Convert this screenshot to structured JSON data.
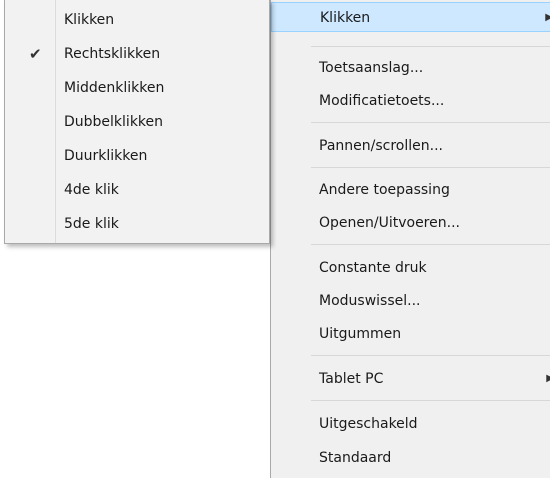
{
  "submenu": {
    "items": [
      {
        "label": "Klikken",
        "checked": false
      },
      {
        "label": "Rechtsklikken",
        "checked": true
      },
      {
        "label": "Middenklikken",
        "checked": false
      },
      {
        "label": "Dubbelklikken",
        "checked": false
      },
      {
        "label": "Duurklikken",
        "checked": false
      },
      {
        "label": "4de klik",
        "checked": false
      },
      {
        "label": "5de klik",
        "checked": false
      }
    ],
    "check_glyph": "✔"
  },
  "mainmenu": {
    "items": [
      {
        "label": "Klikken",
        "highlighted": true,
        "has_submenu": true
      },
      {
        "label": "Toetsaanslag..."
      },
      {
        "label": "Modificatietoets..."
      },
      {
        "label": "Pannen/scrollen..."
      },
      {
        "label": "Andere toepassing"
      },
      {
        "label": "Openen/Uitvoeren..."
      },
      {
        "label": "Constante druk"
      },
      {
        "label": "Moduswissel..."
      },
      {
        "label": "Uitgummen"
      },
      {
        "label": "Tablet PC",
        "has_submenu": true
      },
      {
        "label": "Uitgeschakeld"
      },
      {
        "label": "Standaard"
      }
    ],
    "arrow_glyph": "▶"
  },
  "colors": {
    "highlight": "#cde8ff",
    "highlight_border": "#99d1ff",
    "menu_bg": "#f0f0f0"
  }
}
